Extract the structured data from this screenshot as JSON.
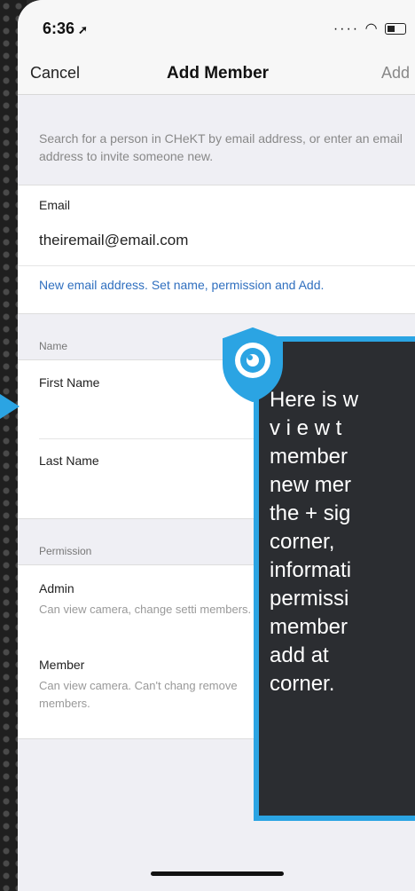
{
  "status": {
    "time": "6:36",
    "location_icon": "location-arrow-icon",
    "signal_icon": "signal-icon",
    "wifi_icon": "wifi-icon",
    "battery_icon": "battery-icon"
  },
  "nav": {
    "cancel": "Cancel",
    "title": "Add Member",
    "add": "Add"
  },
  "hint": "Search for a person in CHeKT by email address, or enter an email address to invite someone new.",
  "email": {
    "label": "Email",
    "value": "theiremail@email.com",
    "note": "New email address. Set name, permission and Add."
  },
  "name_section": {
    "header": "Name",
    "first": "First Name",
    "last": "Last Name"
  },
  "permission_section": {
    "header": "Permission",
    "options": [
      {
        "title": "Admin",
        "desc": "Can view camera, change setti members."
      },
      {
        "title": "Member",
        "desc": "Can view camera. Can't chang remove members."
      }
    ]
  },
  "callout": {
    "text": "Here is w\nv i e w  t\nmember\nnew mer\nthe + sig\ncorner,\ninformati\npermissi\nmember\nadd at\ncorner.",
    "accent": "#2ba4e3",
    "background": "#2b2d31"
  }
}
